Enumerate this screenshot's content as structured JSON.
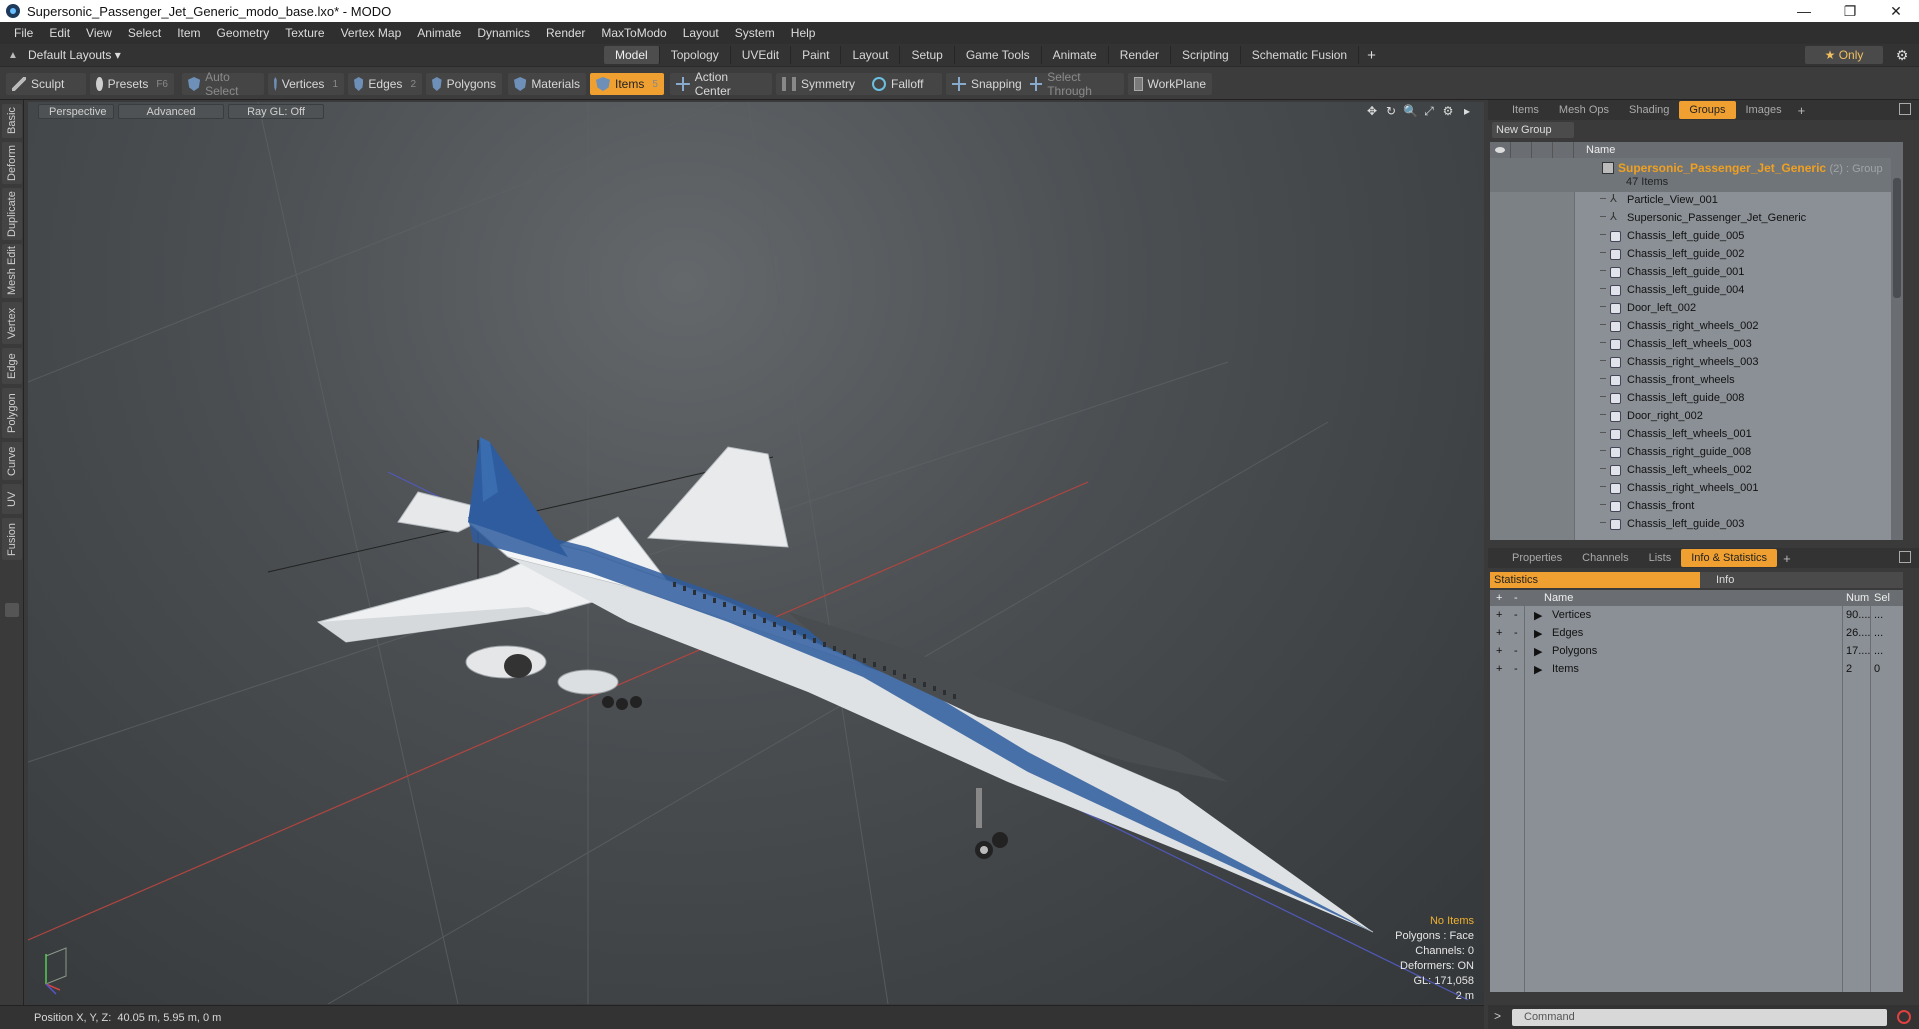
{
  "window": {
    "title": "Supersonic_Passenger_Jet_Generic_modo_base.lxo* - MODO",
    "controls": [
      "—",
      "❐",
      "✕"
    ]
  },
  "menu": [
    "File",
    "Edit",
    "View",
    "Select",
    "Item",
    "Geometry",
    "Texture",
    "Vertex Map",
    "Animate",
    "Dynamics",
    "Render",
    "MaxToModo",
    "Layout",
    "System",
    "Help"
  ],
  "layoutbar": {
    "layouts_label": "Default Layouts ▾",
    "tabs": [
      "Model",
      "Topology",
      "UVEdit",
      "Paint",
      "Layout",
      "Setup",
      "Game Tools",
      "Animate",
      "Render",
      "Scripting",
      "Schematic Fusion"
    ],
    "active_tab": "Model",
    "plus": "+",
    "only_label": "★ Only",
    "gear": "⚙"
  },
  "toolbar": {
    "sculpt": "Sculpt",
    "presets": "Presets",
    "presets_key": "F6",
    "auto_select": "Auto Select",
    "vertices": "Vertices",
    "vertices_key": "1",
    "edges": "Edges",
    "edges_key": "2",
    "polygons": "Polygons",
    "materials": "Materials",
    "items": "Items",
    "items_key": "5",
    "action_center": "Action Center",
    "symmetry": "Symmetry",
    "falloff": "Falloff",
    "snapping": "Snapping",
    "select_through": "Select Through",
    "workplane": "WorkPlane"
  },
  "left_tabs": [
    "Basic",
    "Deform",
    "Duplicate",
    "Mesh Edit",
    "Vertex",
    "Edge",
    "Polygon",
    "Curve",
    "UV",
    "Fusion"
  ],
  "viewport": {
    "view_mode": "Perspective",
    "shading": "Advanced",
    "raygl": "Ray GL: Off",
    "icons": [
      "✥",
      "↻",
      "🔍",
      "⤢",
      "⚙",
      "▸"
    ],
    "stats": {
      "no_items": "No Items",
      "polygons": "Polygons : Face",
      "channels": "Channels: 0",
      "deformers": "Deformers: ON",
      "gl": "GL: 171,058",
      "scale": "2 m"
    }
  },
  "statusbar": {
    "position_label": "Position X, Y, Z:",
    "position_value": "40.05 m, 5.95 m, 0 m"
  },
  "top_panel": {
    "tabs": [
      "Items",
      "Mesh Ops",
      "Shading",
      "Groups",
      "Images"
    ],
    "active_tab": "Groups",
    "plus": "+",
    "new_group": "New Group",
    "name_header": "Name",
    "group_name": "Supersonic_Passenger_Jet_Generic",
    "group_tag": "(2) : Group",
    "group_count": "47 Items",
    "items": [
      {
        "name": "Particle_View_001",
        "kind": "locator"
      },
      {
        "name": "Supersonic_Passenger_Jet_Generic",
        "kind": "locator"
      },
      {
        "name": "Chassis_left_guide_005",
        "kind": "mesh"
      },
      {
        "name": "Chassis_left_guide_002",
        "kind": "mesh"
      },
      {
        "name": "Chassis_left_guide_001",
        "kind": "mesh"
      },
      {
        "name": "Chassis_left_guide_004",
        "kind": "mesh"
      },
      {
        "name": "Door_left_002",
        "kind": "mesh"
      },
      {
        "name": "Chassis_right_wheels_002",
        "kind": "mesh"
      },
      {
        "name": "Chassis_left_wheels_003",
        "kind": "mesh"
      },
      {
        "name": "Chassis_right_wheels_003",
        "kind": "mesh"
      },
      {
        "name": "Chassis_front_wheels",
        "kind": "mesh"
      },
      {
        "name": "Chassis_left_guide_008",
        "kind": "mesh"
      },
      {
        "name": "Door_right_002",
        "kind": "mesh"
      },
      {
        "name": "Chassis_left_wheels_001",
        "kind": "mesh"
      },
      {
        "name": "Chassis_right_guide_008",
        "kind": "mesh"
      },
      {
        "name": "Chassis_left_wheels_002",
        "kind": "mesh"
      },
      {
        "name": "Chassis_right_wheels_001",
        "kind": "mesh"
      },
      {
        "name": "Chassis_front",
        "kind": "mesh"
      },
      {
        "name": "Chassis_left_guide_003",
        "kind": "mesh"
      }
    ]
  },
  "bottom_panel": {
    "tabs": [
      "Properties",
      "Channels",
      "Lists",
      "Info & Statistics"
    ],
    "active_tab": "Info & Statistics",
    "plus": "+",
    "statistics_label": "Statistics",
    "info_label": "Info",
    "headers": {
      "name": "Name",
      "num": "Num",
      "sel": "Sel"
    },
    "rows": [
      {
        "name": "Vertices",
        "num": "90....",
        "sel": "..."
      },
      {
        "name": "Edges",
        "num": "26....",
        "sel": "..."
      },
      {
        "name": "Polygons",
        "num": "17....",
        "sel": "..."
      },
      {
        "name": "Items",
        "num": "2",
        "sel": "0"
      }
    ]
  },
  "command": {
    "prompt": ">",
    "placeholder": "Command"
  }
}
